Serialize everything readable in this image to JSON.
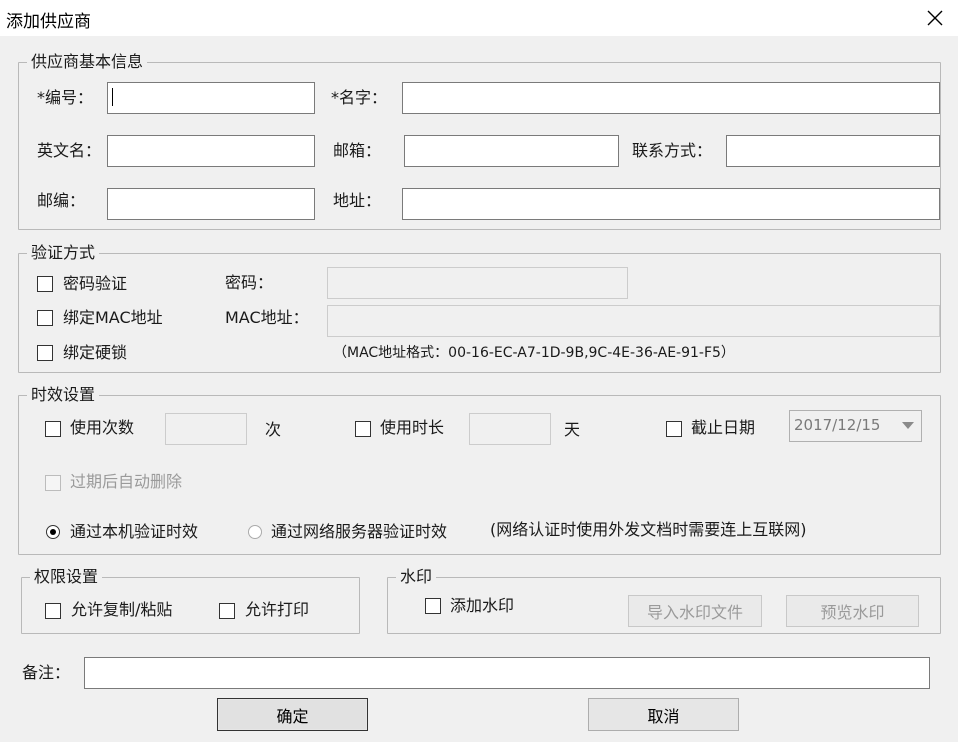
{
  "window": {
    "title": "添加供应商"
  },
  "basic": {
    "legend": "供应商基本信息",
    "code_label": "*编号：",
    "name_label": "*名字：",
    "en_name_label": "英文名：",
    "email_label": "邮箱：",
    "contact_label": "联系方式：",
    "zip_label": "邮编：",
    "address_label": "地址：",
    "code_value": "",
    "name_value": "",
    "en_name_value": "",
    "email_value": "",
    "contact_value": "",
    "zip_value": "",
    "address_value": ""
  },
  "auth": {
    "legend": "验证方式",
    "password_check": "密码验证",
    "password_label": "密码：",
    "password_value": "",
    "mac_check": "绑定MAC地址",
    "mac_label": "MAC地址：",
    "mac_value": "",
    "dongle_check": "绑定硬锁",
    "mac_hint": "（MAC地址格式：00-16-EC-A7-1D-9B,9C-4E-36-AE-91-F5）"
  },
  "validity": {
    "legend": "时效设置",
    "use_count_check": "使用次数",
    "use_count_value": "",
    "count_unit": "次",
    "use_duration_check": "使用时长",
    "use_duration_value": "",
    "duration_unit": "天",
    "deadline_check": "截止日期",
    "deadline_value": "2017/12/15",
    "auto_delete_check": "过期后自动删除",
    "radio_local": "通过本机验证时效",
    "radio_server": "通过网络服务器验证时效",
    "network_hint": "(网络认证时使用外发文档时需要连上互联网)"
  },
  "permissions": {
    "legend": "权限设置",
    "copy_paste": "允许复制/粘贴",
    "print": "允许打印"
  },
  "watermark": {
    "legend": "水印",
    "add_watermark": "添加水印",
    "import_button": "导入水印文件",
    "preview_button": "预览水印"
  },
  "remarks": {
    "label": "备注：",
    "value": ""
  },
  "footer": {
    "ok_button": "确定",
    "cancel_button": "取消"
  }
}
